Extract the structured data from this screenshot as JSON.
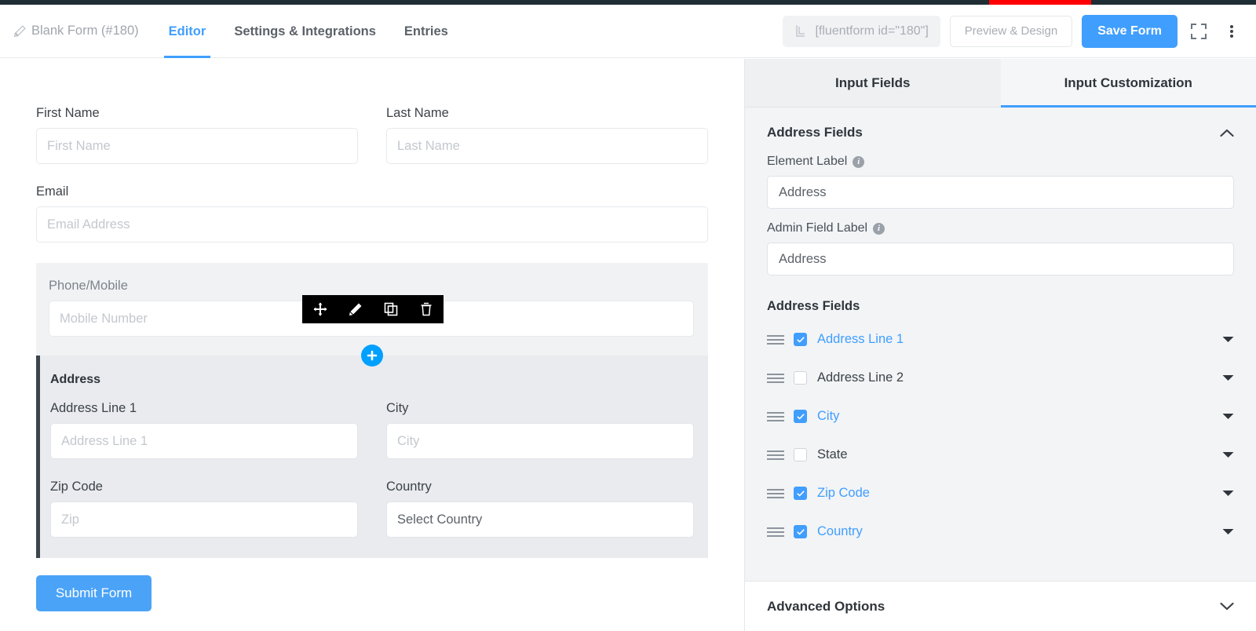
{
  "header": {
    "form_title": "Blank Form (#180)",
    "edit_icon": "pencil-icon",
    "tabs": [
      {
        "label": "Editor",
        "active": true
      },
      {
        "label": "Settings & Integrations",
        "active": false
      },
      {
        "label": "Entries",
        "active": false
      }
    ],
    "shortcode": "[fluentform id=\"180\"]",
    "shortcode_icon": "shortcode-copy-icon",
    "preview_label": "Preview & Design",
    "save_label": "Save Form",
    "fullscreen_icon": "fullscreen-expand-icon",
    "more_icon": "kebab-menu-icon",
    "accent_color": "#409eff",
    "strip_color": "#1f2d34",
    "strip_alert_color": "#ff0000"
  },
  "form": {
    "fields": [
      {
        "label": "First Name",
        "placeholder": "First Name"
      },
      {
        "label": "Last Name",
        "placeholder": "Last Name"
      },
      {
        "label": "Email",
        "placeholder": "Email Address"
      }
    ],
    "phone_block": {
      "label": "Phone/Mobile",
      "placeholder": "Mobile Number",
      "toolbar": [
        {
          "name": "move-icon",
          "title": "Move"
        },
        {
          "name": "edit-icon",
          "title": "Edit"
        },
        {
          "name": "duplicate-icon",
          "title": "Duplicate"
        },
        {
          "name": "delete-icon",
          "title": "Delete"
        }
      ],
      "add_icon": "plus-icon"
    },
    "address_block": {
      "title": "Address",
      "fields": [
        {
          "label": "Address Line 1",
          "placeholder": "Address Line 1",
          "value": ""
        },
        {
          "label": "City",
          "placeholder": "City",
          "value": ""
        },
        {
          "label": "Zip Code",
          "placeholder": "Zip",
          "value": ""
        },
        {
          "label": "Country",
          "placeholder": "",
          "value": "Select Country"
        }
      ]
    },
    "submit_label": "Submit Form"
  },
  "panel": {
    "tabs": [
      {
        "label": "Input Fields",
        "active": false
      },
      {
        "label": "Input Customization",
        "active": true
      }
    ],
    "section_title": "Address Fields",
    "section_collapse_icon": "chevron-up-icon",
    "element_label": {
      "label": "Element Label",
      "info_icon": "info-icon",
      "value": "Address"
    },
    "admin_field_label": {
      "label": "Admin Field Label",
      "info_icon": "info-icon",
      "value": "Address"
    },
    "address_fields_title": "Address Fields",
    "address_fields": [
      {
        "label": "Address Line 1",
        "checked": true
      },
      {
        "label": "Address Line 2",
        "checked": false
      },
      {
        "label": "City",
        "checked": true
      },
      {
        "label": "State",
        "checked": false
      },
      {
        "label": "Zip Code",
        "checked": true
      },
      {
        "label": "Country",
        "checked": true
      }
    ],
    "drag_icon": "drag-handle-icon",
    "expand_icon": "chevron-down-icon",
    "advanced_options_label": "Advanced Options",
    "advanced_options_icon": "chevron-down-icon"
  }
}
